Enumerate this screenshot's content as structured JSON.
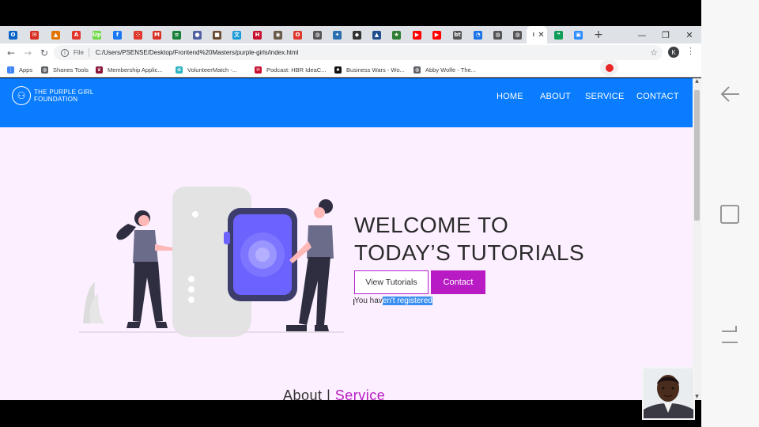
{
  "browser": {
    "tabs": [
      {
        "icon": "outlook-icon",
        "color": "#0a64c8",
        "glyph": "O"
      },
      {
        "icon": "mail-icon",
        "color": "#d93025",
        "glyph": "✉"
      },
      {
        "icon": "shapes-icon",
        "color": "#e37400",
        "glyph": "▲"
      },
      {
        "icon": "acrobat-icon",
        "color": "#e0362c",
        "glyph": "A"
      },
      {
        "icon": "upwork-icon",
        "color": "#6fda44",
        "glyph": "Up"
      },
      {
        "icon": "facebook-icon",
        "color": "#1877f2",
        "glyph": "f"
      },
      {
        "icon": "dots-icon",
        "color": "#e0362c",
        "glyph": "⁘"
      },
      {
        "icon": "gmail-icon",
        "color": "#d93025",
        "glyph": "M"
      },
      {
        "icon": "sheet-icon",
        "color": "#188038",
        "glyph": "≡"
      },
      {
        "icon": "circle-icon",
        "color": "#5060a0",
        "glyph": "●"
      },
      {
        "icon": "photo-icon",
        "color": "#6b4a2f",
        "glyph": "■"
      },
      {
        "icon": "translate-icon",
        "color": "#1a9ad6",
        "glyph": "文"
      },
      {
        "icon": "hbr-icon",
        "color": "#c8102e",
        "glyph": "H"
      },
      {
        "icon": "badge-icon",
        "color": "#6a5a4a",
        "glyph": "◉"
      },
      {
        "icon": "opera-icon",
        "color": "#e0362c",
        "glyph": "O"
      },
      {
        "icon": "globe-icon",
        "color": "#555555",
        "glyph": "◍"
      },
      {
        "icon": "bird-icon",
        "color": "#2a6fb0",
        "glyph": "✦"
      },
      {
        "icon": "bear-icon",
        "color": "#333333",
        "glyph": "◆"
      },
      {
        "icon": "cap-icon",
        "color": "#1e4e8c",
        "glyph": "▲"
      },
      {
        "icon": "star-icon",
        "color": "#2e7d32",
        "glyph": "★"
      },
      {
        "icon": "youtube-icon",
        "color": "#ff0000",
        "glyph": "▶"
      },
      {
        "icon": "youtube-icon",
        "color": "#ff0000",
        "glyph": "▶"
      },
      {
        "icon": "text-icon",
        "color": "#555555",
        "glyph": "bt"
      },
      {
        "icon": "clock-icon",
        "color": "#1a73e8",
        "glyph": "◔"
      },
      {
        "icon": "globe-icon",
        "color": "#555555",
        "glyph": "◍"
      },
      {
        "icon": "globe-icon",
        "color": "#555555",
        "glyph": "◍"
      },
      {
        "icon": "document-icon",
        "color": "#5f6368",
        "glyph": "I"
      },
      {
        "icon": "hangouts-icon",
        "color": "#0f9d58",
        "glyph": "❝"
      },
      {
        "icon": "zoom-icon",
        "color": "#2d8cff",
        "glyph": "▣"
      }
    ],
    "close_glyph": "✕",
    "new_tab_glyph": "+",
    "window_controls": {
      "minimize": "—",
      "restore": "❐",
      "close": "✕"
    },
    "url_scheme_label": "File",
    "url": "C:/Users/PSENSE/Desktop/Frontend%20Masters/purple-girls/index.html",
    "profile_initial": "K",
    "bookmarks": [
      {
        "label": "Apps",
        "icon": "apps-grid-icon",
        "color": "#4285f4",
        "glyph": "⋮"
      },
      {
        "label": "Shanes Tools",
        "icon": "globe-icon",
        "color": "#5f6368",
        "glyph": "◍"
      },
      {
        "label": "Membership Applic...",
        "icon": "crest-icon",
        "color": "#8a1538",
        "glyph": "♛"
      },
      {
        "label": "VolunteerMatch -...",
        "icon": "volunteer-icon",
        "color": "#2bb3c0",
        "glyph": "✿"
      },
      {
        "label": "Podcast: HBR IdeaC...",
        "icon": "hbr-icon",
        "color": "#c8102e",
        "glyph": "H"
      },
      {
        "label": "Business Wars - Wo...",
        "icon": "podcast-icon",
        "color": "#111111",
        "glyph": "♠"
      },
      {
        "label": "Abby Wolfe - The...",
        "icon": "globe-icon",
        "color": "#5f6368",
        "glyph": "◍"
      }
    ]
  },
  "site": {
    "logo_line1": "THE PURPLE GIRL",
    "logo_line2": "FOUNDATION",
    "nav": [
      "HOME",
      "ABOUT",
      "SERVICE",
      "CONTACT"
    ],
    "hero_line1": "WELCOME TO",
    "hero_line2": "TODAY’S TUTORIALS",
    "btn_primary": "View Tutorials",
    "btn_secondary": "Contact",
    "register_note_plain": "You hav",
    "register_note_selected": "en't registered",
    "section_heading_a": "About",
    "section_heading_b": "Service"
  },
  "colors": {
    "nav_blue": "#0a7cff",
    "brand_purple": "#b81bc3",
    "page_bg": "#fcefff",
    "selection": "#3a8ff0"
  }
}
